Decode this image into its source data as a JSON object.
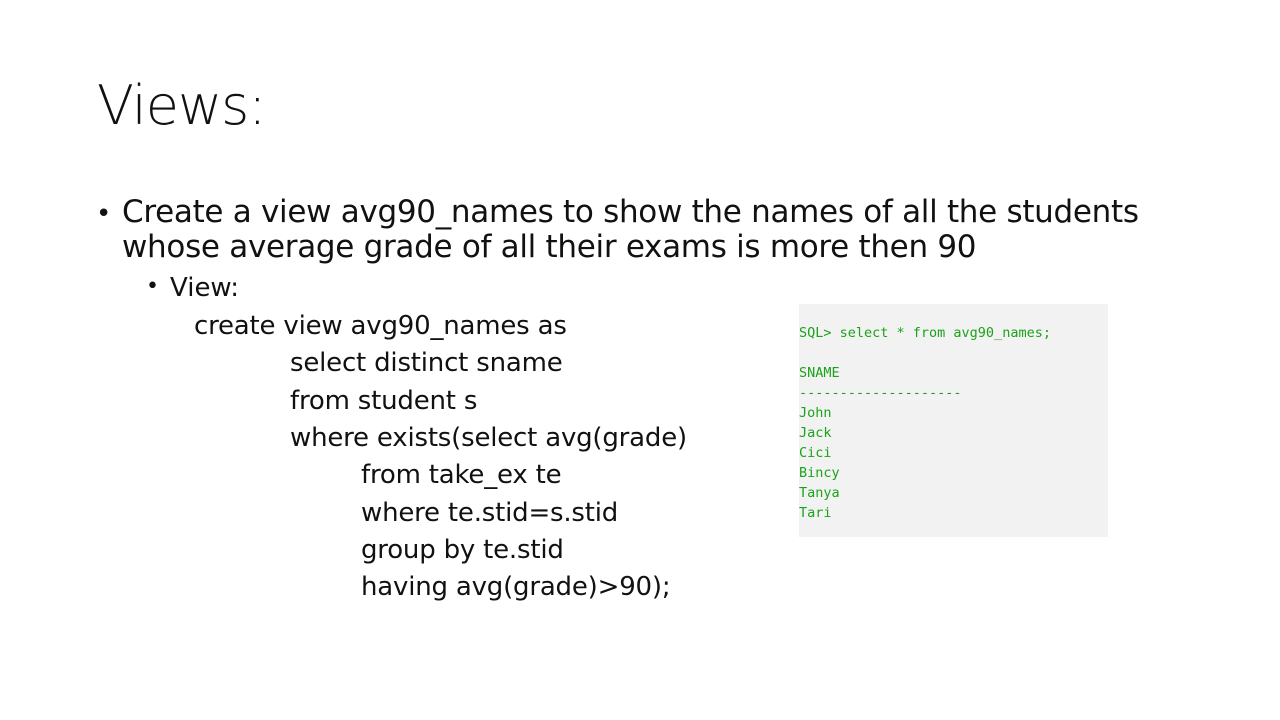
{
  "slide": {
    "title": "Views:",
    "bullet_text": "Create a view avg90_names to show the names of all the students whose average grade of all their exams is more then 90",
    "sub_bullet": "View:",
    "sql_lines": [
      "create view  avg90_names as",
      "select distinct sname",
      "from student s",
      "where exists(select avg(grade)",
      "from take_ex te",
      "where te.stid=s.stid",
      "group by te.stid",
      "having avg(grade)>90);"
    ]
  },
  "terminal": {
    "command": "SQL> select * from avg90_names;",
    "column_header": "SNAME",
    "separator": "--------------------",
    "rows": [
      "John",
      "Jack",
      "Cici",
      "Bincy",
      "Tanya",
      "Tari"
    ]
  },
  "colors": {
    "text": "#111111",
    "terminal_background": "#f2f2f2",
    "terminal_text": "#1aa31a"
  }
}
